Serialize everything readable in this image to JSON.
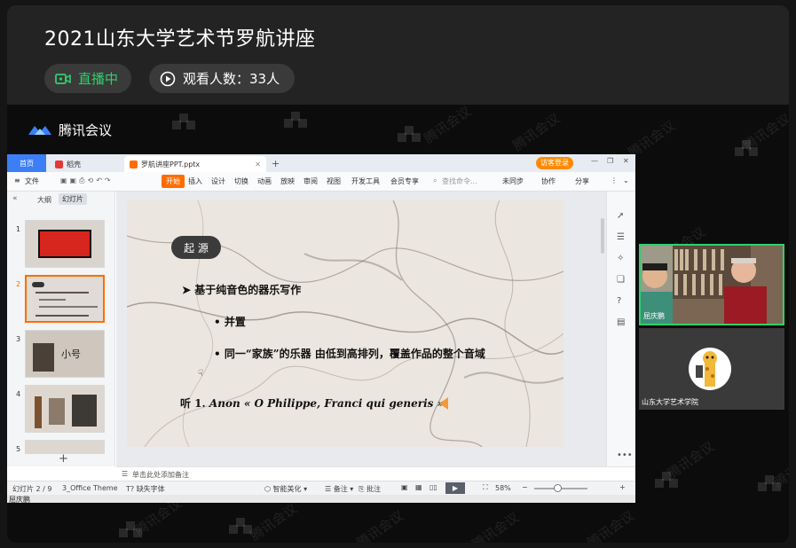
{
  "page": {
    "title": "2021山东大学艺术节罗航讲座",
    "live_status": "直播中",
    "viewers": "观看人数：33人"
  },
  "meeting": {
    "brand": "腾讯会议",
    "watermark": "腾讯会议"
  },
  "wps": {
    "tabs": {
      "home": "首页",
      "shell": "稻壳",
      "file": "罗航讲座PPT.pptx"
    },
    "login_button": "访客登录",
    "menu": [
      "文件",
      "开始",
      "插入",
      "设计",
      "切换",
      "动画",
      "放映",
      "审阅",
      "视图",
      "开发工具",
      "会员专享"
    ],
    "search_placeholder": "查找命令...",
    "right_actions": [
      "未同步",
      "协作",
      "分享"
    ],
    "panel_tabs": [
      "大纲",
      "幻灯片"
    ],
    "slide_numbers": [
      "1",
      "2",
      "3",
      "4",
      "5"
    ],
    "note_placeholder": "单击此处添加备注",
    "status": {
      "slide_count": "幻灯片 2 / 9",
      "theme": "3_Office Theme",
      "missing_font": "缺失字体",
      "smart_beautify": "智能美化",
      "notes": "备注",
      "comments": "批注",
      "zoom": "58%"
    }
  },
  "slide": {
    "badge": "起 源",
    "heading": "基于纯音色的器乐写作",
    "bullet1": "并置",
    "bullet2": "同一“家族”的乐器 由低到高排列，覆盖作品的整个音域",
    "listen_prefix": "听  1.",
    "listen_work": "Anon « O Philippe, Franci qui generis »"
  },
  "thumb_texts": {
    "t3_title": "小号"
  },
  "participants": [
    {
      "name": "屈庆鹏"
    },
    {
      "name": "山东大学艺术学院"
    }
  ],
  "presenter": "屈庆鹏",
  "colors": {
    "live_green": "#2fd06c",
    "wps_orange": "#ff6d00",
    "tab_blue": "#3c7ef6"
  }
}
